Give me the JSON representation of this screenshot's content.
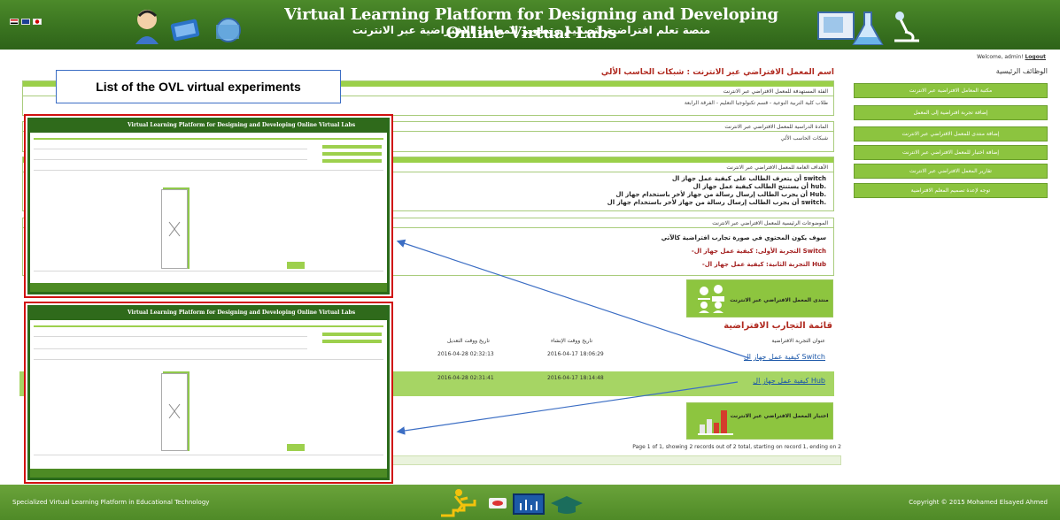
{
  "header": {
    "title_en": "Virtual Learning Platform for Designing and Developing Online Virtual Labs",
    "title_ar": "منصة تعلم افتراضية لتصميم وتطوير المعامل الافتراضية عبر الانترنت"
  },
  "user": {
    "welcome": "Welcome, admin!",
    "logout": "Logout"
  },
  "sidebar": {
    "title": "الوظائف الرئيسية",
    "items": [
      {
        "label": "مكتبة المعامل الافتراضية عبر الانترنت"
      },
      {
        "label": "إضافة تجربة افتراضية إلى المعمل"
      },
      {
        "label": "إضافة منتدى للمعمل الافتراضي عبر الانترنت"
      },
      {
        "label": "إضافة اختبار للمعمل الافتراضي عبر الانترنت"
      },
      {
        "label": "تقارير المعمل الافتراضي عبر الانترنت"
      },
      {
        "label": "توجه لإعدة تصميم المعلم الافتراضية"
      }
    ]
  },
  "main": {
    "page_title": "اسم المعمل الافتراضي عبر الانترنت : شبكات الحاسب الألي",
    "panels": [
      {
        "header": "الفئة المستهدفة للمعمل الافتراضي عبر الانترنت",
        "body": "طلاب كلية التربية النوعية - قسم تكنولوجيا التعليم - الفرقة الرابعة"
      },
      {
        "header": "المادة الدراسية للمعمل الافتراضي عبر الانترنت",
        "body": "شبكات الحاسب الألي"
      },
      {
        "header": "الأهداف العامة للمعمل الافتراضي عبر الانترنت",
        "bullets": [
          "أن يتعرف الطالب على كيفية عمل جهاز ال switch",
          "أن يستنتج الطالب كيفية عمل جهاز ال hub.",
          "أن يجرب الطالب إرسال رسالة من جهاز لأخر باستخدام جهاز ال Hub.",
          "أن يجرب الطالب إرسال رسالة من جهاز لأخر باستخدام جهاز ال switch."
        ]
      },
      {
        "header": "الموضوعات الرئيسية للمعمل الافتراضي عبر الانترنت",
        "intro": "سوف يكون المحتوي في صورة تجارب افتراضية كالآتي",
        "items": [
          "-التجربة الأولى: كيفية عمل جهاز ال Switch",
          "-التجربة الثانية: كيفية عمل جهاز ال Hub"
        ]
      }
    ],
    "forum_tile": "منتدى المعمل الافتراضي عبر الانترنت",
    "list_title": "قائمة التجارب الافتراضية",
    "table": {
      "headers": [
        "عنوان التجربة الافتراضية",
        "تاريخ ووقت الإنشاء",
        "تاريخ ووقت التعديل"
      ],
      "rows": [
        {
          "title": "كيفية عمل جهاز ال Switch",
          "created": "2016-04-17 18:06:29",
          "modified": "2016-04-28 02:32:13"
        },
        {
          "title": "كيفية عمل جهاز ال Hub",
          "created": "2016-04-17 18:14:48",
          "modified": "2016-04-28 02:31:41"
        }
      ]
    },
    "exam_tile": "اختبار المعمل الافتراضي عبر الانترنت",
    "pager": "Page 1 of 1, showing 2 records out of 2 total, starting on record 1, ending on 2"
  },
  "callout": "List of the OVL virtual experiments",
  "footer": {
    "left": "Specialized Virtual Learning Platform in Educational Technology",
    "right": "Copyright © 2015 Mohamed Elsayed Ahmed"
  },
  "colors": {
    "header": "#3a7420",
    "accent": "#8cc43f",
    "title_red": "#b02a20",
    "highlight": "#d01010",
    "arrow": "#3c6ec4"
  }
}
